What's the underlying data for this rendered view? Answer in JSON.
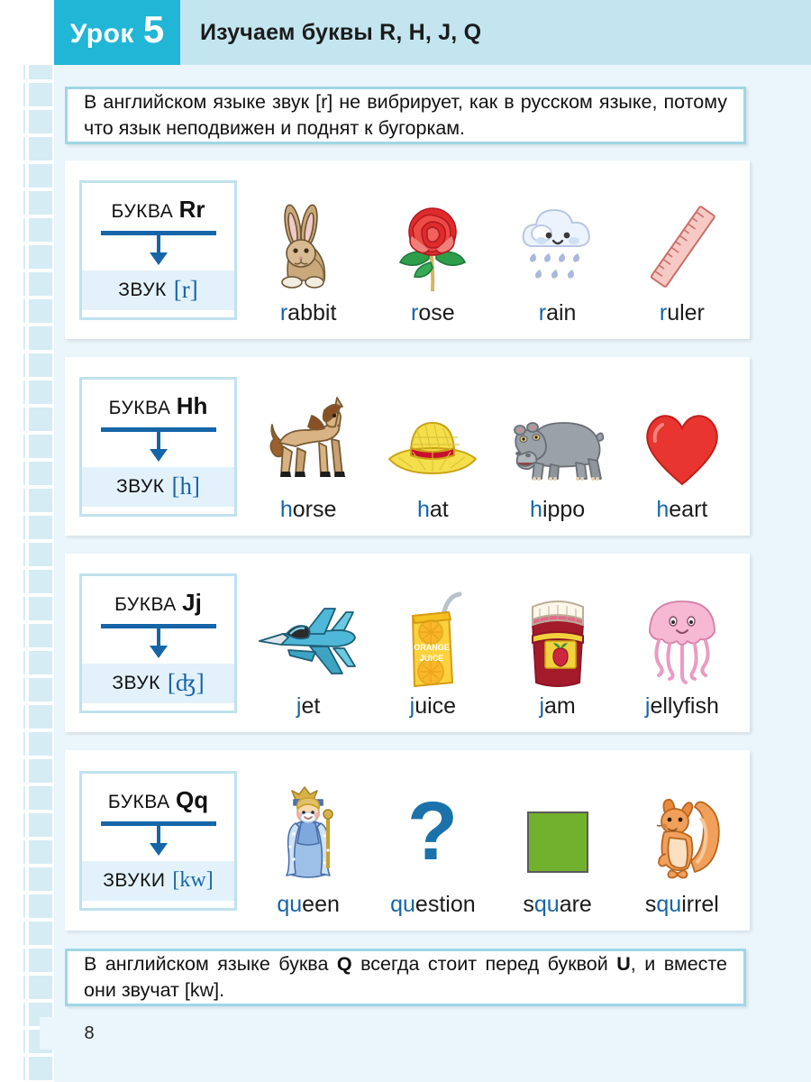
{
  "header": {
    "lesson_word": "Урок",
    "lesson_number": "5",
    "title": "Изучаем буквы R, H, J, Q",
    "lesson_box_color": "#21b6d6",
    "band_color": "#c3e5ef"
  },
  "notes": {
    "top": "В английском языке звук [r] не вибрирует, как в русском языке, потому что язык неподвижен и поднят к бугоркам.",
    "bottom_part1": "В английском языке буква ",
    "bottom_q": "Q",
    "bottom_part2": " всегда стоит перед буквой ",
    "bottom_u": "U",
    "bottom_part3": ", и вместе они звучат [kw]."
  },
  "accent_color": "#1565a8",
  "rows": [
    {
      "letter_label": "БУКВА",
      "letter": "Rr",
      "sound_label": "ЗВУК",
      "sound": "[r]",
      "items": [
        {
          "word_head": "r",
          "word_tail": "abbit",
          "icon": "rabbit-icon"
        },
        {
          "word_head": "r",
          "word_tail": "ose",
          "icon": "rose-icon"
        },
        {
          "word_head": "r",
          "word_tail": "ain",
          "icon": "rain-cloud-icon"
        },
        {
          "word_head": "r",
          "word_tail": "uler",
          "icon": "ruler-icon"
        }
      ]
    },
    {
      "letter_label": "БУКВА",
      "letter": "Hh",
      "sound_label": "ЗВУК",
      "sound": "[h]",
      "items": [
        {
          "word_head": "h",
          "word_tail": "orse",
          "icon": "horse-icon"
        },
        {
          "word_head": "h",
          "word_tail": "at",
          "icon": "hat-icon"
        },
        {
          "word_head": "h",
          "word_tail": "ippo",
          "icon": "hippo-icon"
        },
        {
          "word_head": "h",
          "word_tail": "eart",
          "icon": "heart-icon"
        }
      ]
    },
    {
      "letter_label": "БУКВА",
      "letter": "Jj",
      "sound_label": "ЗВУК",
      "sound": "[ʤ]",
      "items": [
        {
          "word_head": "j",
          "word_tail": "et",
          "icon": "jet-icon"
        },
        {
          "word_head": "j",
          "word_tail": "uice",
          "icon": "juice-box-icon"
        },
        {
          "word_head": "j",
          "word_tail": "am",
          "icon": "jam-jar-icon"
        },
        {
          "word_head": "j",
          "word_tail": "ellyfish",
          "icon": "jellyfish-icon"
        }
      ]
    },
    {
      "letter_label": "БУКВА",
      "letter": "Qq",
      "sound_label": "ЗВУКИ",
      "sound": "[kw]",
      "items": [
        {
          "word_pre": "",
          "word_head": "qu",
          "word_tail": "een",
          "icon": "queen-icon"
        },
        {
          "word_pre": "",
          "word_head": "qu",
          "word_tail": "estion",
          "icon": "question-mark-icon"
        },
        {
          "word_pre": "s",
          "word_head": "qu",
          "word_tail": "are",
          "icon": "green-square-icon"
        },
        {
          "word_pre": "s",
          "word_head": "qu",
          "word_tail": "irrel",
          "icon": "squirrel-icon"
        }
      ]
    }
  ],
  "juice_box": {
    "line1": "ORANGE",
    "line2": "JUICE"
  },
  "page_number": "8"
}
